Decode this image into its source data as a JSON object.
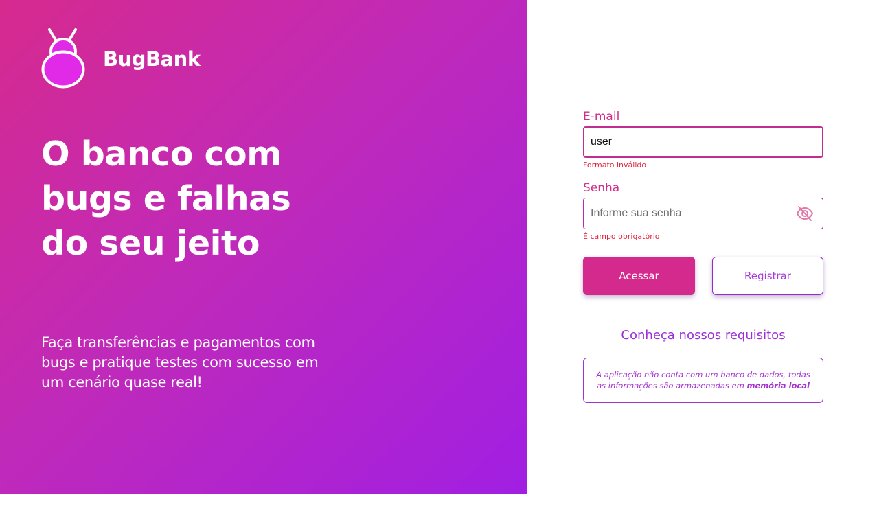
{
  "brand": {
    "name": "BugBank",
    "logo_icon": "bug-logo-icon"
  },
  "hero": {
    "headline_lines": [
      "O banco com",
      "bugs e falhas",
      "do seu jeito"
    ],
    "subtext_lines": [
      "Faça transferências e pagamentos com",
      "bugs e pratique testes com sucesso em",
      "um cenário quase real!"
    ]
  },
  "login_form": {
    "email": {
      "label": "E-mail",
      "value": "user",
      "error": "Formato inválido"
    },
    "password": {
      "label": "Senha",
      "placeholder": "Informe sua senha",
      "value": "",
      "error": "É campo obrigatório",
      "toggle_icon": "eye-off-icon"
    },
    "access_button": "Acessar",
    "register_button": "Registrar",
    "requirements_link": "Conheça nossos requisitos",
    "notice": {
      "text": "A aplicação não conta com um banco de dados, todas as informações são armazenadas em",
      "emphasis": "memória local"
    }
  },
  "colors": {
    "gradient_start": "#d62a8e",
    "gradient_end": "#a11fe3",
    "accent_pink": "#d52a8d",
    "accent_purple": "#9c2fd8",
    "error": "#e2263f"
  }
}
